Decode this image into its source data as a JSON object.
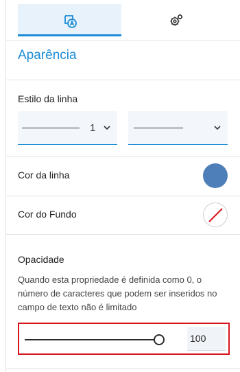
{
  "tabs": [
    {
      "icon": "appearance-text-icon",
      "active": true
    },
    {
      "icon": "gear-settings-icon",
      "active": false
    }
  ],
  "section_title": "Aparência",
  "line_style": {
    "label": "Estilo da linha",
    "width_value": "1"
  },
  "line_color": {
    "label": "Cor da linha",
    "color": "#4f7fb8"
  },
  "background_color": {
    "label": "Cor do Fundo",
    "value": "none"
  },
  "opacity": {
    "label": "Opacidade",
    "help": "Quando esta propriedade é definida como 0, o número de caracteres que podem ser inseridos no campo de texto não é limitado",
    "value": "100",
    "level": 1.0
  },
  "colors": {
    "accent": "#1a8bd6",
    "highlight_border": "#d7141d"
  }
}
